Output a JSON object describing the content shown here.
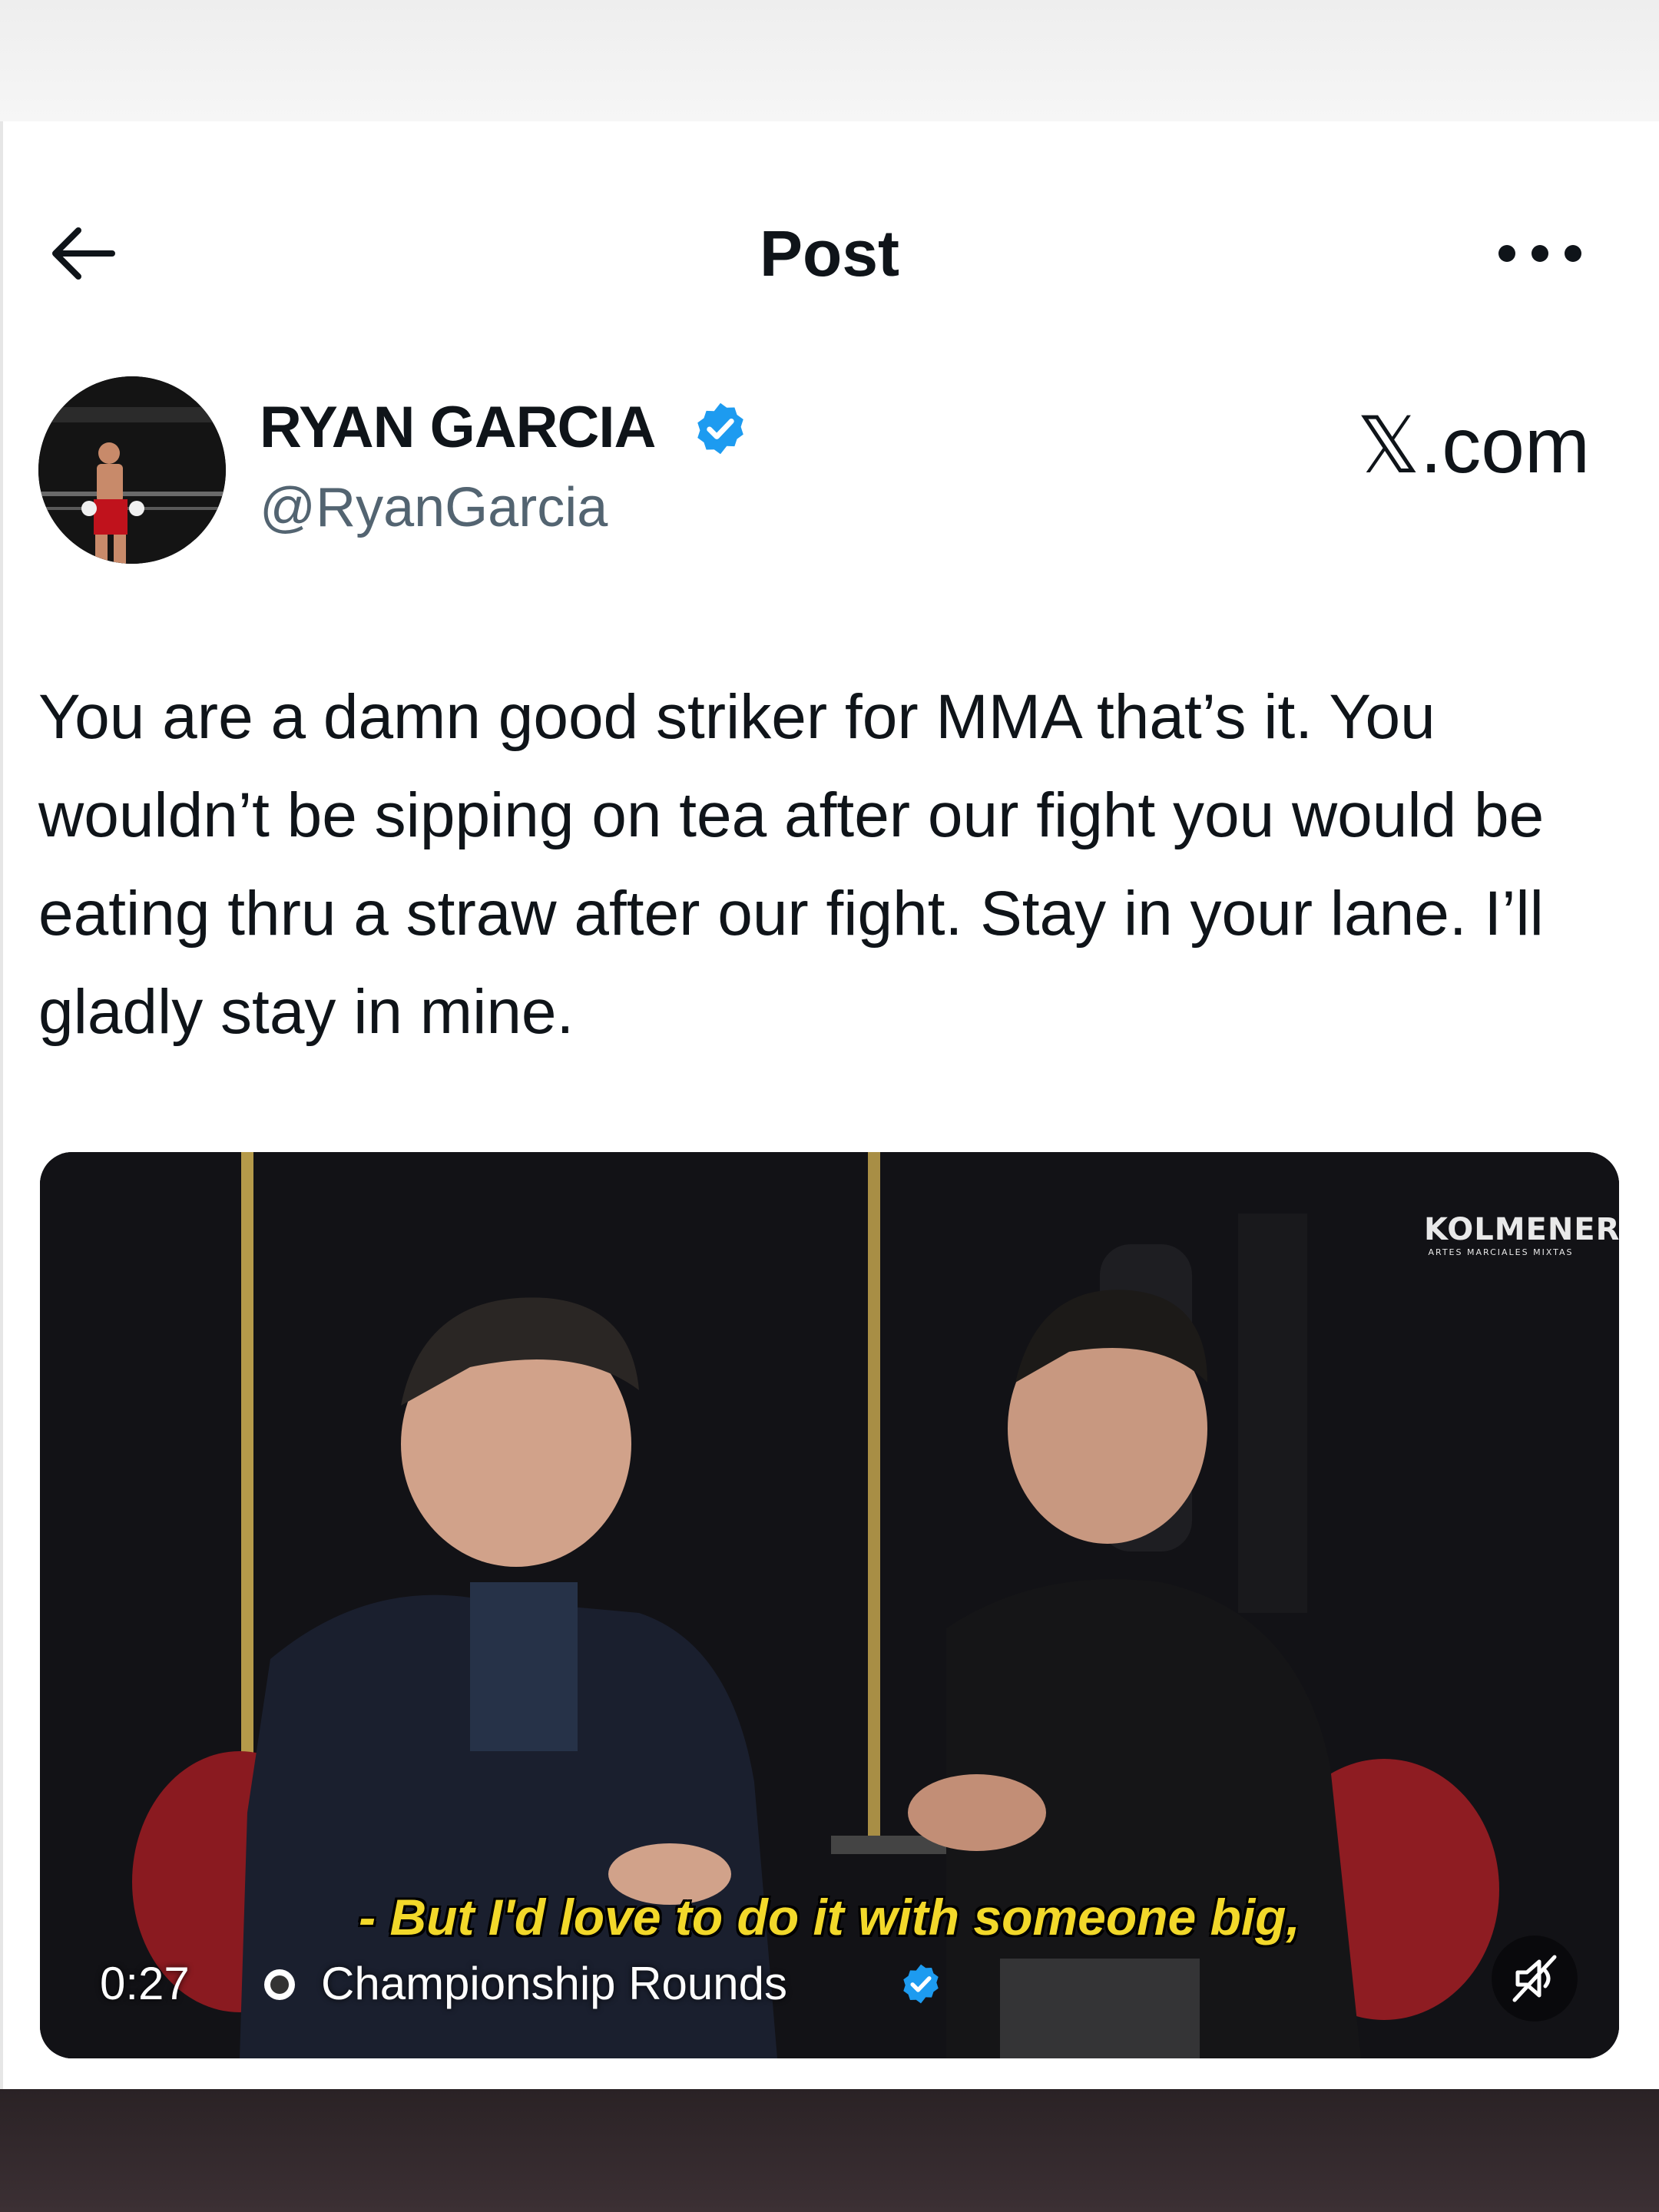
{
  "header": {
    "title": "Post",
    "back_icon": "arrow-left-icon",
    "more_icon": "more-horizontal-icon"
  },
  "author": {
    "name": "RYAN GARCIA",
    "handle": "@RyanGarcia",
    "verified": true,
    "verified_color": "#1d9bf0"
  },
  "brand": {
    "label": "𝕏.com"
  },
  "tweet": {
    "text": "You are a damn good striker for MMA that’s it. You wouldn’t be sipping on tea after our fight you would be eating thru a straw after our fight. Stay in your lane. I’ll gladly stay in mine."
  },
  "media": {
    "watermark_name": "KOLMENERO",
    "watermark_sub": "ARTES MARCIALES MIXTAS",
    "subtitle": "- But I'd love to do it with someone big,",
    "timestamp": "0:27",
    "source": "Championship Rounds",
    "source_verified": true,
    "muted": true,
    "mute_icon": "speaker-muted-icon"
  }
}
